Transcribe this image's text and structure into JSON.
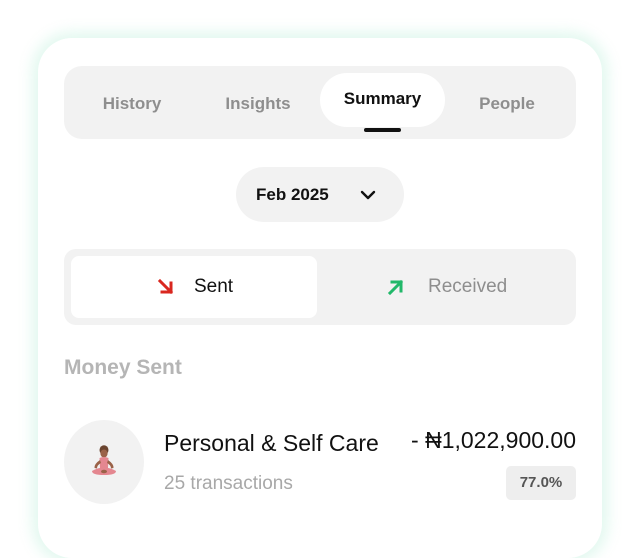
{
  "tabs": [
    {
      "label": "History"
    },
    {
      "label": "Insights"
    },
    {
      "label": "Summary"
    },
    {
      "label": "People"
    }
  ],
  "active_tab": "Summary",
  "month_selector": {
    "value": "Feb 2025",
    "icon": "chevron-down-icon"
  },
  "direction_toggle": {
    "sent_label": "Sent",
    "received_label": "Received",
    "selected": "Sent",
    "sent_icon": "arrow-down-right-icon",
    "received_icon": "arrow-up-right-icon"
  },
  "section": {
    "title": "Money Sent"
  },
  "categories": [
    {
      "name": "Personal & Self Care",
      "transactions": "25 transactions",
      "amount": "- ₦1,022,900.00",
      "percent": "77.0%",
      "icon": "meditation-icon"
    }
  ],
  "colors": {
    "sent_arrow": "#d9271f",
    "received_arrow": "#22b86a",
    "glow": "#bef0dc"
  }
}
